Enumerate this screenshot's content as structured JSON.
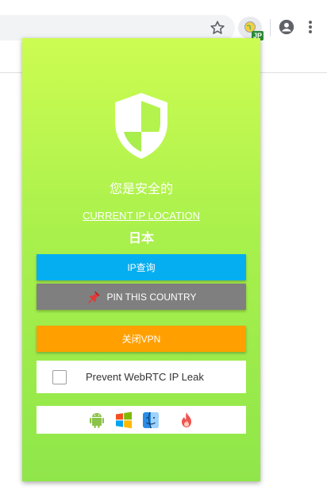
{
  "toolbar": {
    "extension_badge": "JP"
  },
  "popup": {
    "status_text": "您是安全的",
    "location_link": "CURRENT IP LOCATION",
    "country": "日本",
    "buttons": {
      "ip_lookup": "IP查询",
      "pin_country": "PIN THIS COUNTRY",
      "close_vpn": "关闭VPN"
    },
    "webrtc": {
      "label": "Prevent WebRTC IP Leak",
      "checked": false
    },
    "platforms": [
      "android-icon",
      "windows-icon",
      "macos-finder-icon",
      "fire-icon"
    ]
  },
  "colors": {
    "popup_gradient_top": "#ccfc52",
    "popup_gradient_bottom": "#8fe64a",
    "ip_button": "#05aef0",
    "pin_button": "#7f7f7f",
    "vpn_button": "#ffa000",
    "badge": "#2e8b3a"
  }
}
